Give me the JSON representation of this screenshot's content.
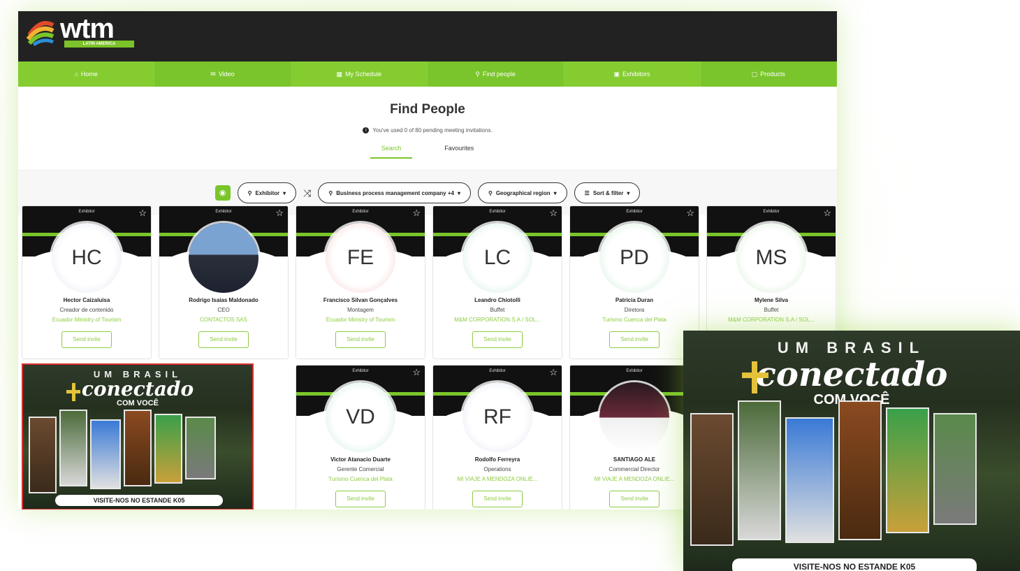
{
  "brand": {
    "logo": "wtm",
    "sub": "LATIN AMERICA",
    "accent": "#7ac52b"
  },
  "nav": [
    {
      "label": "Home",
      "icon": "home-icon"
    },
    {
      "label": "Video",
      "icon": "chat-icon"
    },
    {
      "label": "My Schedule",
      "icon": "calendar-icon"
    },
    {
      "label": "Find people",
      "icon": "search-icon"
    },
    {
      "label": "Exhibitors",
      "icon": "building-icon"
    },
    {
      "label": "Products",
      "icon": "box-icon"
    }
  ],
  "header": {
    "title": "Find People",
    "notice": "You've used 0 of 80 pending meeting invitations.",
    "tabs": [
      "Search",
      "Favourites"
    ]
  },
  "filters": {
    "type": "Exhibitor",
    "business": "Business process management company +4",
    "region": "Geographical region",
    "sort": "Sort & filter"
  },
  "card_tag": "Exhibitor",
  "invite_label": "Send invite",
  "cards": [
    {
      "initials": "HC",
      "name": "Hector Caizaluisa",
      "role": "Creador de contenido",
      "company": "Ecuador Ministry of Tourism"
    },
    {
      "initials": "",
      "name": "Rodrigo Isaias Maldonado",
      "role": "CEO",
      "company": "CONTACTOS SAS"
    },
    {
      "initials": "FE",
      "name": "Francisco Silvan Gonçalves",
      "role": "Montagem",
      "company": "Ecuador Ministry of Tourism"
    },
    {
      "initials": "LC",
      "name": "Leandro Chiotolli",
      "role": "Buffet",
      "company": "M&M CORPORATION S.A / SOL..."
    },
    {
      "initials": "PD",
      "name": "Patricia Duran",
      "role": "Diretora",
      "company": "Turismo Cuenca del Plata"
    },
    {
      "initials": "MS",
      "name": "Mylene Silva",
      "role": "Buffet",
      "company": "M&M CORPORATION S.A / SOL..."
    },
    {
      "initials": "VD",
      "name": "Victor Atanacio Duarte",
      "role": "Gerente Comercial",
      "company": "Turismo Cuenca del Plata"
    },
    {
      "initials": "RF",
      "name": "Rodolfo Ferreyra",
      "role": "Operations",
      "company": "MI VIAJE A MENDOZA ONLIE..."
    },
    {
      "initials": "",
      "name": "SANTIAGO ALE",
      "role": "Commercial Director",
      "company": "MI VIAJE A MENDOZA ONLIE..."
    }
  ],
  "poster": {
    "top": "UM BRASIL",
    "script": "conectado",
    "sub": "COM VOCÊ",
    "bottom": "VISITE-NOS NO ESTANDE K05"
  }
}
